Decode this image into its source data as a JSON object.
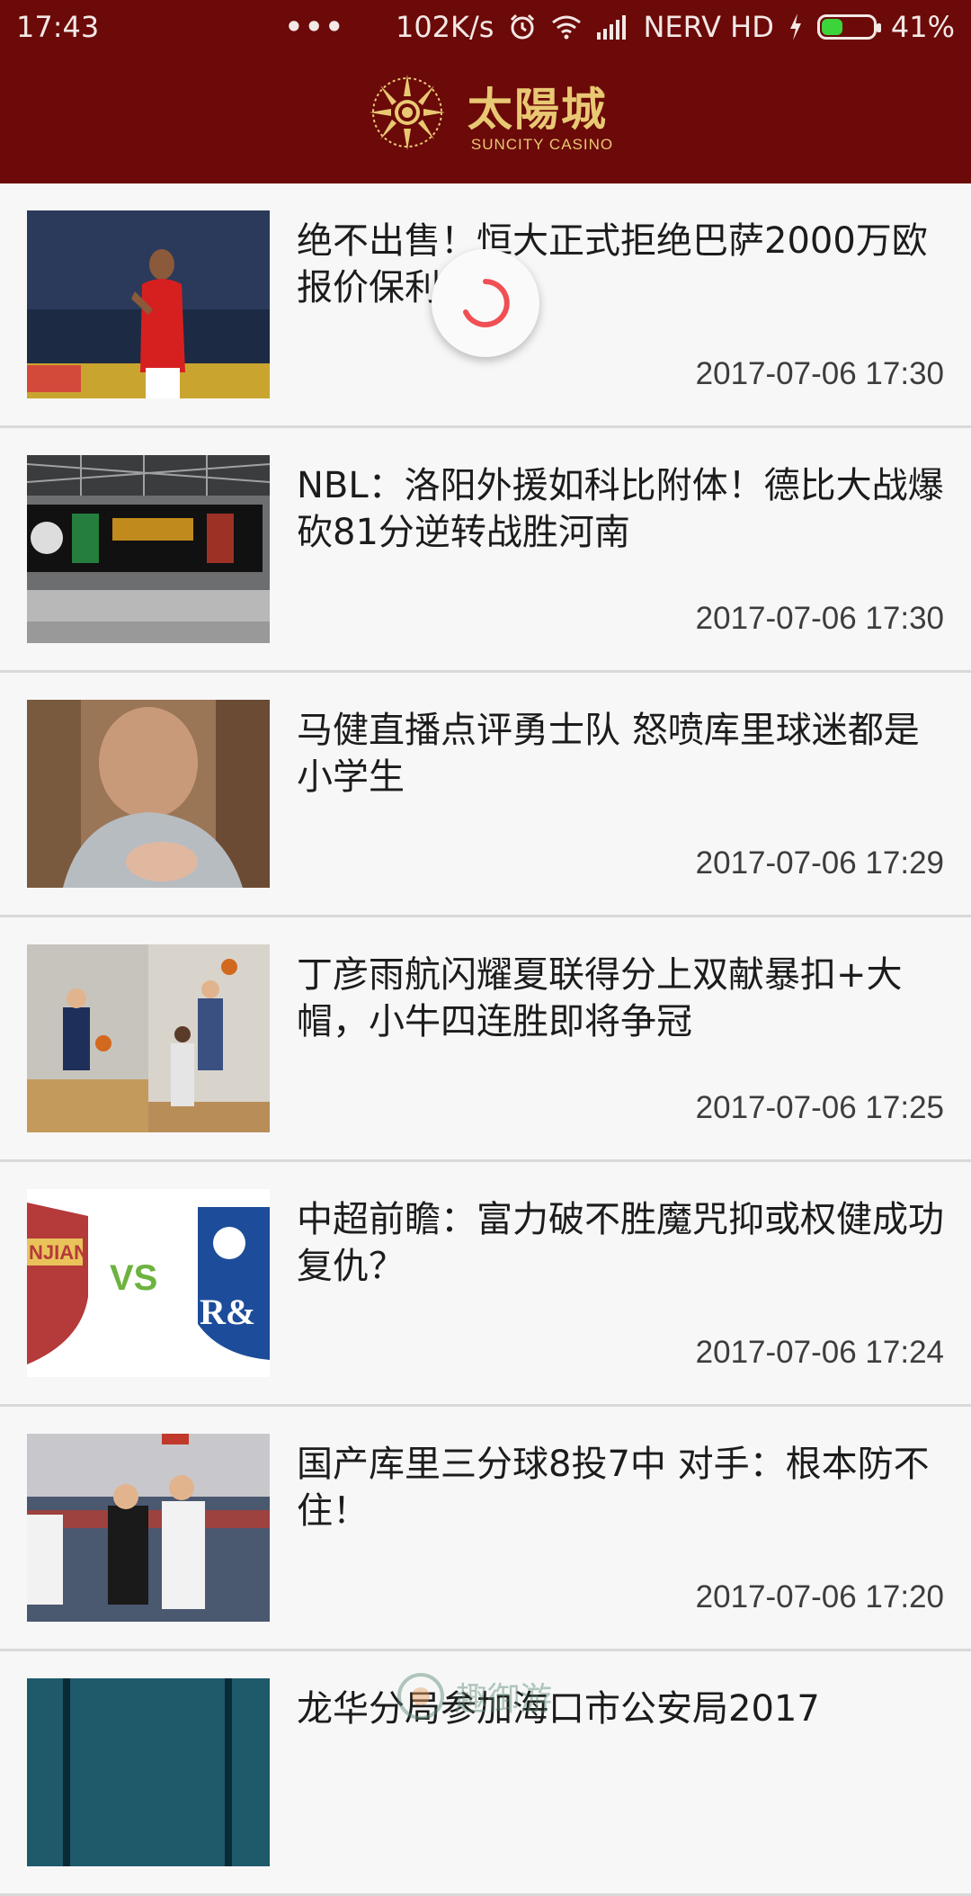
{
  "status_bar": {
    "time": "17:43",
    "dots": "•••",
    "speed": "102K/s",
    "carrier": "NERV HD",
    "battery_text": "41%",
    "battery_level": 0.41,
    "battery_color": "#3bd43a",
    "icons": [
      "alarm-icon",
      "wifi-icon",
      "signal-icon",
      "charging-icon",
      "battery-icon"
    ]
  },
  "header": {
    "logo_cn": "太陽城",
    "logo_en": "SUNCITY CASINO",
    "emblem_text": "太陽城",
    "emblem_script": "Suncity",
    "background": "#6b0a08",
    "accent": "#e9c874"
  },
  "news": [
    {
      "title": "绝不出售！恒大正式拒绝巴萨2000万欧报价保利尼奥",
      "time": "2017-07-06 17:30",
      "image": "football-player-photo"
    },
    {
      "title": "NBL：洛阳外援如科比附体！德比大战爆砍81分逆转战胜河南",
      "time": "2017-07-06 17:30",
      "image": "scoreboard-photo"
    },
    {
      "title": "马健直播点评勇士队 怒喷库里球迷都是小学生",
      "time": "2017-07-06 17:29",
      "image": "man-pointing-photo"
    },
    {
      "title": "丁彦雨航闪耀夏联得分上双献暴扣+大帽，小牛四连胜即将争冠",
      "time": "2017-07-06 17:25",
      "image": "basketball-game-photo"
    },
    {
      "title": "中超前瞻：富力破不胜魔咒抑或权健成功复仇？",
      "time": "2017-07-06 17:24",
      "image": "team-crests-vs-image",
      "vs_text": "VS",
      "crest_left": "NJIAN",
      "crest_right": "R&"
    },
    {
      "title": "国产库里三分球8投7中 对手：根本防不住！",
      "time": "2017-07-06 17:20",
      "image": "basketball-players-photo"
    },
    {
      "title": "龙华分局参加海口市公安局2017",
      "time": "",
      "image": "partial-photo"
    }
  ],
  "watermark": {
    "text": "趣御游"
  },
  "spinner_color": "#f04f53"
}
